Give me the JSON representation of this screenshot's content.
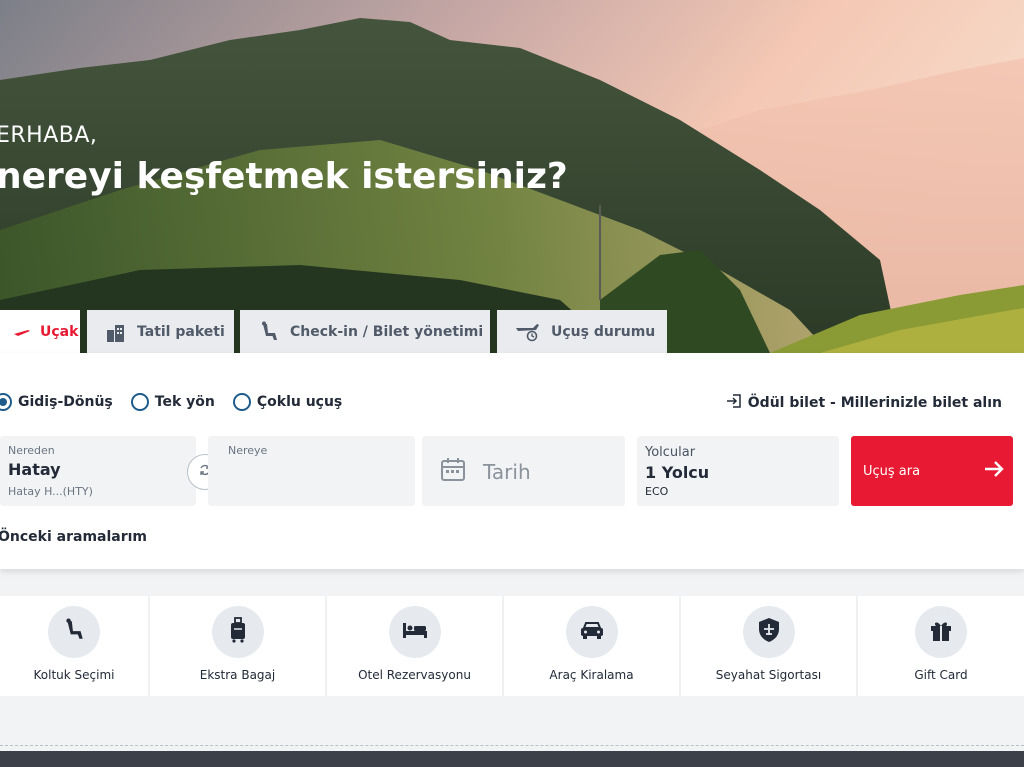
{
  "hero": {
    "greeting": "ERHABA,",
    "headline": "nereyi keşfetmek istersiniz?"
  },
  "tabs": [
    {
      "label": "Uçak",
      "icon": "plane-icon",
      "active": true
    },
    {
      "label": "Tatil paketi",
      "icon": "city-icon",
      "active": false
    },
    {
      "label": "Check-in / Bilet yönetimi",
      "icon": "seat-icon",
      "active": false
    },
    {
      "label": "Uçuş durumu",
      "icon": "flight-status-icon",
      "active": false
    }
  ],
  "trip_types": [
    {
      "label": "Gidiş-Dönüş",
      "checked": true
    },
    {
      "label": "Tek yön",
      "checked": false
    },
    {
      "label": "Çoklu uçuş",
      "checked": false
    }
  ],
  "award_link": "Ödül bilet - Millerinizle bilet alın",
  "from": {
    "label": "Nereden",
    "value": "Hatay",
    "sub": "Hatay H...(HTY)"
  },
  "to": {
    "label": "Nereye"
  },
  "date": {
    "placeholder": "Tarih"
  },
  "passengers": {
    "label": "Yolcular",
    "value": "1 Yolcu",
    "cabin": "ECO"
  },
  "search_button": "Uçuş ara",
  "recent_searches": "Önceki aramalarım",
  "services": [
    {
      "label": "Koltuk Seçimi",
      "icon": "seat-icon"
    },
    {
      "label": "Ekstra Bagaj",
      "icon": "luggage-icon"
    },
    {
      "label": "Otel Rezervasyonu",
      "icon": "bed-icon"
    },
    {
      "label": "Araç Kiralama",
      "icon": "car-icon"
    },
    {
      "label": "Seyahat Sigortası",
      "icon": "shield-plane-icon"
    },
    {
      "label": "Gift Card",
      "icon": "gift-icon"
    }
  ],
  "colors": {
    "accent": "#e81932",
    "radio": "#1f5c8b",
    "text": "#232b38"
  }
}
